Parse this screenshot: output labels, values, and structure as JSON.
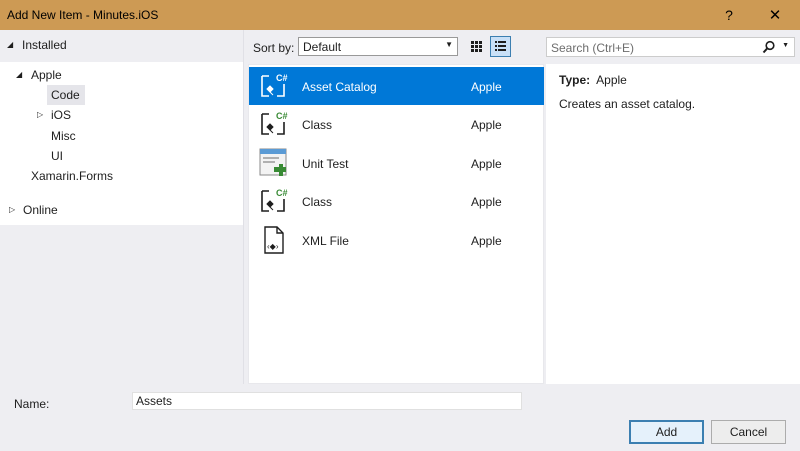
{
  "window": {
    "title": "Add New Item - Minutes.iOS",
    "help_glyph": "?",
    "close_glyph": "✕"
  },
  "tree": {
    "installed": "Installed",
    "apple": "Apple",
    "code": "Code",
    "ios": "iOS",
    "misc": "Misc",
    "ui": "UI",
    "xamarin": "Xamarin.Forms",
    "online": "Online"
  },
  "toolbar": {
    "sort_label": "Sort by:",
    "sort_value": "Default",
    "search_placeholder": "Search (Ctrl+E)"
  },
  "templates": [
    {
      "name": "Asset Catalog",
      "category": "Apple",
      "icon": "csharp-code-icon",
      "selected": true
    },
    {
      "name": "Class",
      "category": "Apple",
      "icon": "csharp-code-icon",
      "selected": false
    },
    {
      "name": "Unit Test",
      "category": "Apple",
      "icon": "unit-test-icon",
      "selected": false
    },
    {
      "name": "Class",
      "category": "Apple",
      "icon": "csharp-code-icon",
      "selected": false
    },
    {
      "name": "XML File",
      "category": "Apple",
      "icon": "xml-file-icon",
      "selected": false
    }
  ],
  "details": {
    "type_label": "Type:",
    "type_value": "Apple",
    "description": "Creates an asset catalog."
  },
  "footer": {
    "name_label": "Name:",
    "name_value": "Assets",
    "add": "Add",
    "cancel": "Cancel"
  },
  "colors": {
    "titlebar": "#cd9a54",
    "selection": "#0078d7",
    "csharp_green": "#388a34",
    "panel_bg": "#eeeef2"
  }
}
